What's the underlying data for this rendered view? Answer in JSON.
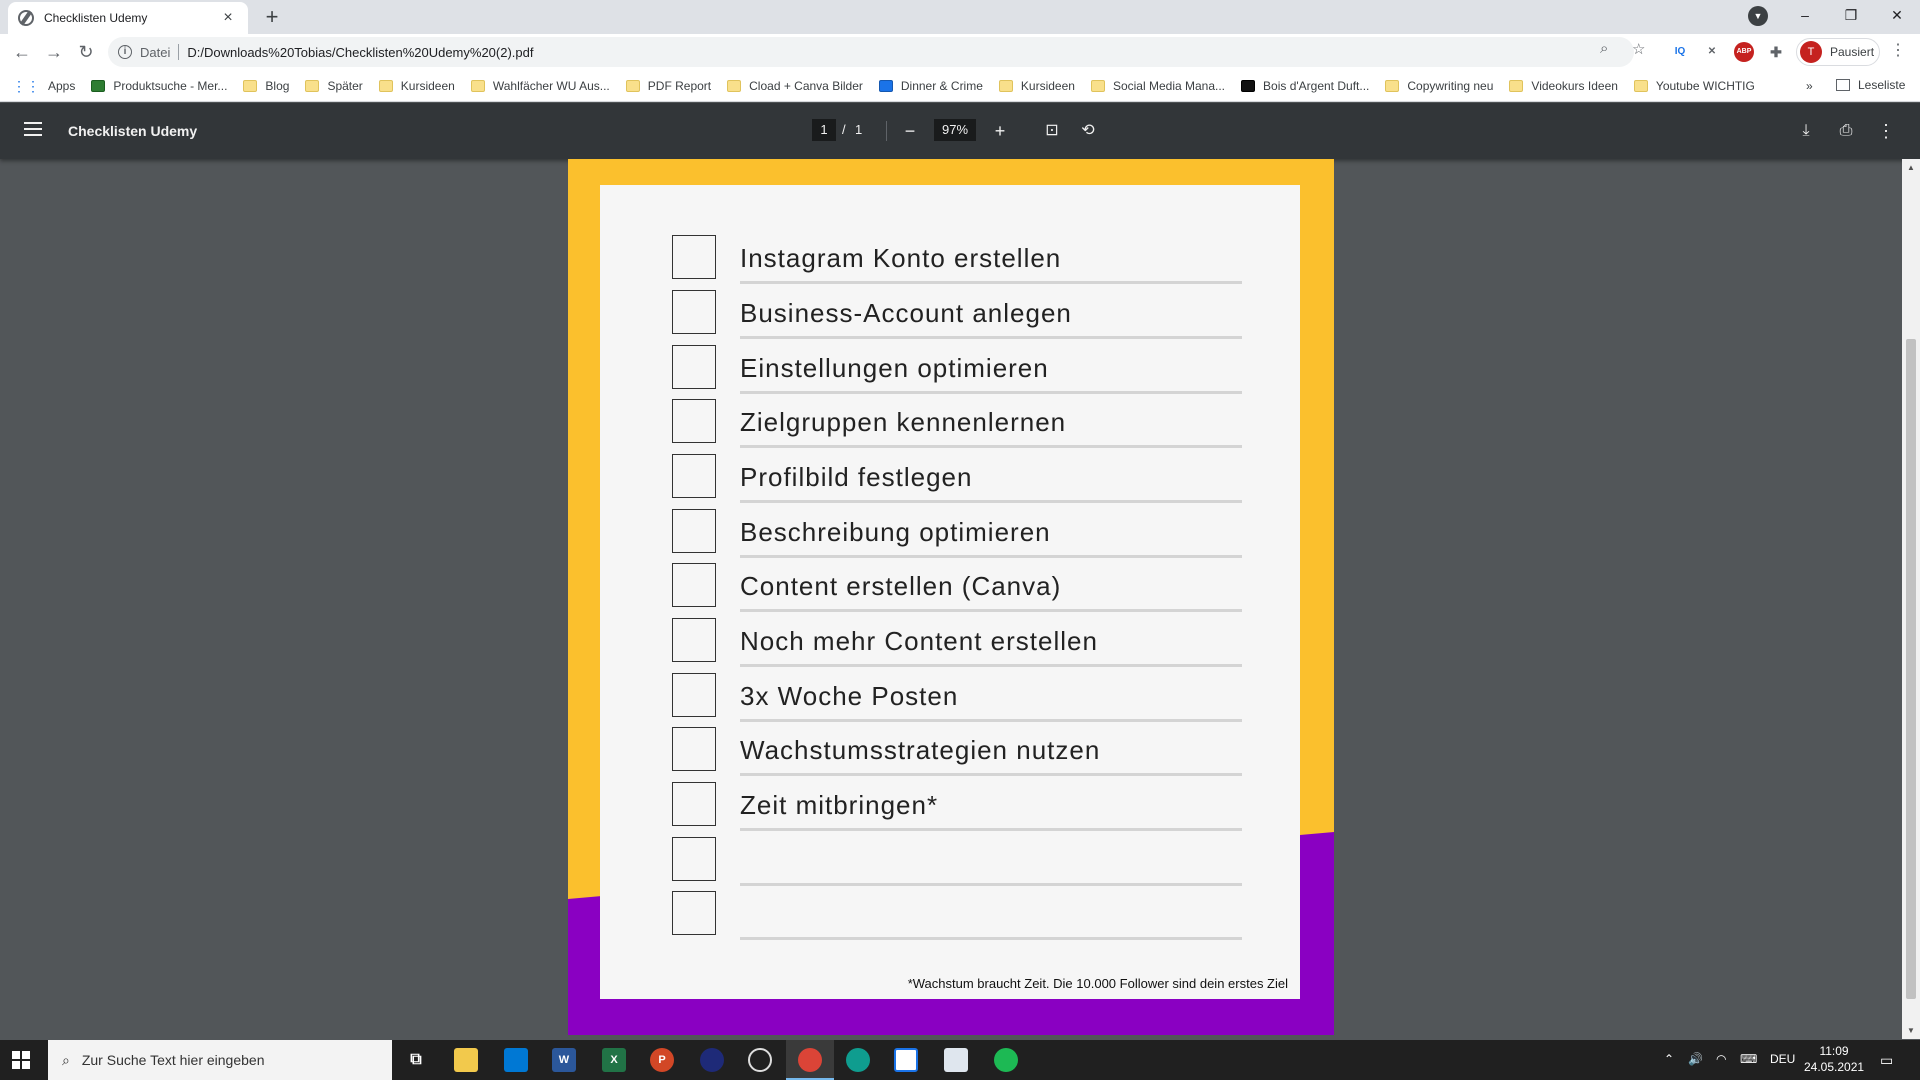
{
  "browser": {
    "tab_title": "Checklisten Udemy",
    "tab_close": "×",
    "new_tab": "+",
    "window_controls": {
      "minimize": "–",
      "restore": "❐",
      "close": "✕"
    },
    "scheme_label": "Datei",
    "url": "D:/Downloads%20Tobias/Checklisten%20Udemy%20(2).pdf",
    "profile_initial": "T",
    "profile_status": "Pausiert",
    "extensions": [
      "IQ",
      "ABP"
    ]
  },
  "bookmarks": {
    "items": [
      {
        "label": "Apps",
        "icon": "apps-grid-icon"
      },
      {
        "label": "Produktsuche - Mer...",
        "icon": "green-favicon"
      },
      {
        "label": "Blog",
        "icon": "folder-icon"
      },
      {
        "label": "Später",
        "icon": "folder-icon"
      },
      {
        "label": "Kursideen",
        "icon": "folder-icon"
      },
      {
        "label": "Wahlfächer WU Aus...",
        "icon": "folder-icon"
      },
      {
        "label": "PDF Report",
        "icon": "folder-icon"
      },
      {
        "label": "Cload + Canva Bilder",
        "icon": "folder-icon"
      },
      {
        "label": "Dinner & Crime",
        "icon": "blue-favicon"
      },
      {
        "label": "Kursideen",
        "icon": "folder-icon"
      },
      {
        "label": "Social Media Mana...",
        "icon": "folder-icon"
      },
      {
        "label": "Bois d'Argent Duft...",
        "icon": "dark-favicon"
      },
      {
        "label": "Copywriting neu",
        "icon": "folder-icon"
      },
      {
        "label": "Videokurs Ideen",
        "icon": "folder-icon"
      },
      {
        "label": "Youtube WICHTIG",
        "icon": "folder-icon"
      }
    ],
    "more": "»",
    "reading_list": "Leseliste"
  },
  "pdf_viewer": {
    "title": "Checklisten Udemy",
    "page_current": "1",
    "page_separator": "/",
    "page_total": "1",
    "zoom": "97%"
  },
  "document": {
    "colors": {
      "accent_yellow": "#FBC02D",
      "accent_purple": "#8A00C2"
    },
    "checklist": [
      "Instagram Konto erstellen",
      "Business-Account anlegen",
      "Einstellungen optimieren",
      "Zielgruppen kennenlernen",
      "Profilbild festlegen",
      "Beschreibung optimieren",
      "Content erstellen (Canva)",
      "Noch mehr Content erstellen",
      "3x Woche Posten",
      "Wachstumsstrategien nutzen",
      "Zeit mitbringen*",
      "",
      ""
    ],
    "footnote": "*Wachstum braucht Zeit. Die 10.000 Follower sind dein erstes Ziel"
  },
  "taskbar": {
    "search_placeholder": "Zur Suche Text hier eingeben",
    "language": "DEU",
    "time": "11:09",
    "date": "24.05.2021"
  }
}
